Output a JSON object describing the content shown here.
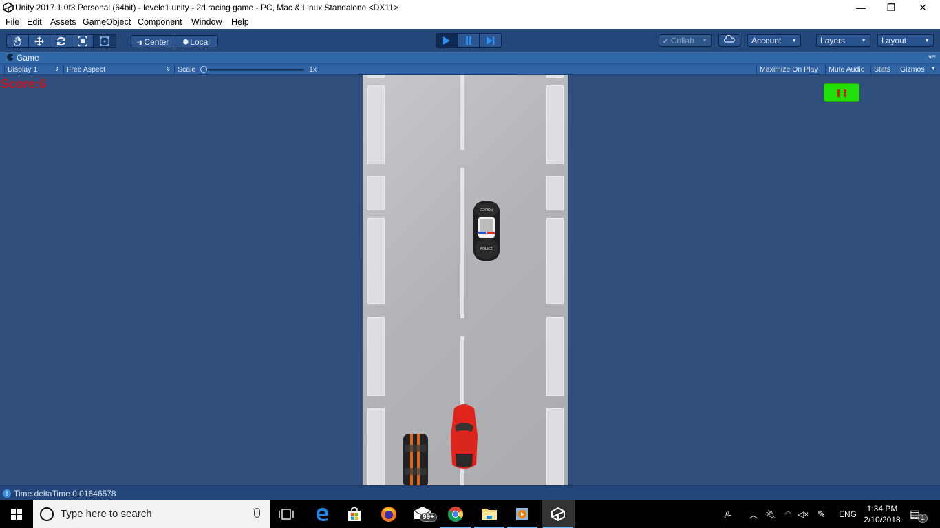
{
  "window": {
    "title": "Unity 2017.1.0f3 Personal (64bit) - levele1.unity - 2d racing game - PC, Mac & Linux Standalone <DX11>",
    "controls": {
      "minimize": "—",
      "restore": "❐",
      "close": "✕"
    }
  },
  "menu": [
    "File",
    "Edit",
    "Assets",
    "GameObject",
    "Component",
    "Window",
    "Help"
  ],
  "toolbar": {
    "transform_tools": [
      "hand-tool",
      "move-tool",
      "rotate-tool",
      "scale-tool",
      "rect-tool"
    ],
    "active_tool": "rect-tool",
    "pivot": {
      "center": "Center",
      "local": "Local"
    },
    "play_controls": [
      "play",
      "pause",
      "step"
    ],
    "collab": "Collab",
    "account": "Account",
    "layers": "Layers",
    "layout": "Layout"
  },
  "game_panel": {
    "tab": "Game",
    "display": "Display 1",
    "aspect": "Free Aspect",
    "scale_label": "Scale",
    "scale_value": "1x",
    "scale_fraction": 0,
    "maximize_on_play": "Maximize On Play",
    "mute_audio": "Mute Audio",
    "stats": "Stats",
    "gizmos": "Gizmos"
  },
  "game": {
    "score": "Score:6",
    "pause_button": "pause",
    "colors": {
      "score": "#c8141a",
      "pause_bg": "#22e00a",
      "pause_bars": "#e0171a"
    },
    "cars": [
      {
        "name": "police-car",
        "label": "POLICE",
        "color": "#1e1e1e"
      },
      {
        "name": "player-red-car",
        "color": "#e0231b"
      },
      {
        "name": "black-orange-striped-car",
        "color": "#222222",
        "stripe": "#e0661a"
      }
    ]
  },
  "statusbar": {
    "message": "Time.deltaTime 0.01646578"
  },
  "taskbar": {
    "search_placeholder": "Type here to search",
    "apps": [
      "task-view",
      "edge",
      "store",
      "firefox",
      "mail",
      "chrome",
      "file-explorer",
      "media-player",
      "unity"
    ],
    "mail_badge": "99+",
    "language": "ENG",
    "time": "1:34 PM",
    "date": "2/10/2018",
    "notification_count": "1"
  }
}
